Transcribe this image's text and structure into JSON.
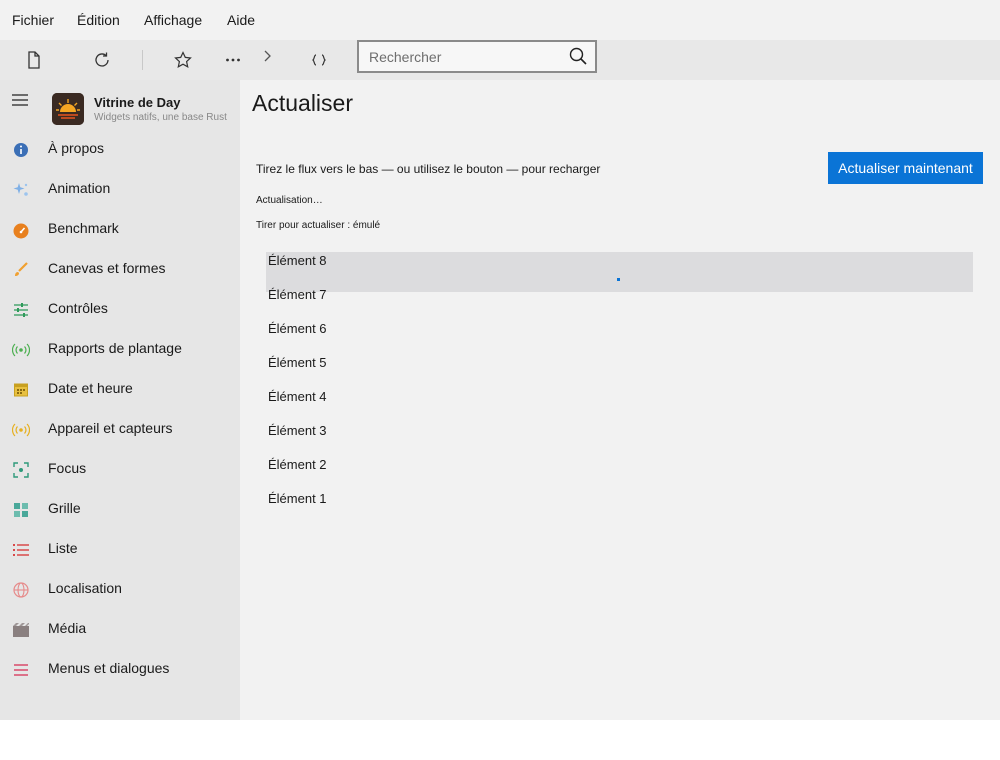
{
  "menu": [
    "Fichier",
    "Édition",
    "Affichage",
    "Aide"
  ],
  "toolbar": {
    "icons": [
      "document-icon",
      "refresh-icon",
      "star-icon",
      "more-icon",
      "chevron-right-icon",
      "braces-icon"
    ],
    "search_placeholder": "Rechercher"
  },
  "app": {
    "title": "Vitrine de Day",
    "subtitle": "Widgets natifs, une base Rust"
  },
  "sidebar": {
    "items": [
      {
        "label": "À propos",
        "icon": "info-icon",
        "color": "#3b6fb6"
      },
      {
        "label": "Animation",
        "icon": "sparkle-icon",
        "color": "#7fb0e6"
      },
      {
        "label": "Benchmark",
        "icon": "speedometer-icon",
        "color": "#e8801e"
      },
      {
        "label": "Canevas et formes",
        "icon": "brush-icon",
        "color": "#f0a030"
      },
      {
        "label": "Contrôles",
        "icon": "sliders-icon",
        "color": "#2e9a5a"
      },
      {
        "label": "Rapports de plantage",
        "icon": "broadcast-icon",
        "color": "#4caf50"
      },
      {
        "label": "Date et heure",
        "icon": "calendar-icon",
        "color": "#c8a020"
      },
      {
        "label": "Appareil et capteurs",
        "icon": "sensor-icon",
        "color": "#e6b020"
      },
      {
        "label": "Focus",
        "icon": "focus-icon",
        "color": "#2e9a7a"
      },
      {
        "label": "Grille",
        "icon": "grid-icon",
        "color": "#4aa89a"
      },
      {
        "label": "Liste",
        "icon": "list-icon",
        "color": "#d94a4a"
      },
      {
        "label": "Localisation",
        "icon": "globe-icon",
        "color": "#e68a8a"
      },
      {
        "label": "Média",
        "icon": "film-icon",
        "color": "#8a8080"
      },
      {
        "label": "Menus et dialogues",
        "icon": "menu-icon",
        "color": "#d94a6a"
      }
    ]
  },
  "page": {
    "title": "Actualiser",
    "description": "Tirez le flux vers le bas — ou utilisez le bouton — pour recharger",
    "button_label": "Actualiser maintenant",
    "status": "Actualisation…",
    "pull_label": "Tirer pour actualiser : émulé",
    "accent": "#0a74d6",
    "items": [
      "Élément 8",
      "Élément 7",
      "Élément 6",
      "Élément 5",
      "Élément 4",
      "Élément 3",
      "Élément 2",
      "Élément 1"
    ]
  }
}
